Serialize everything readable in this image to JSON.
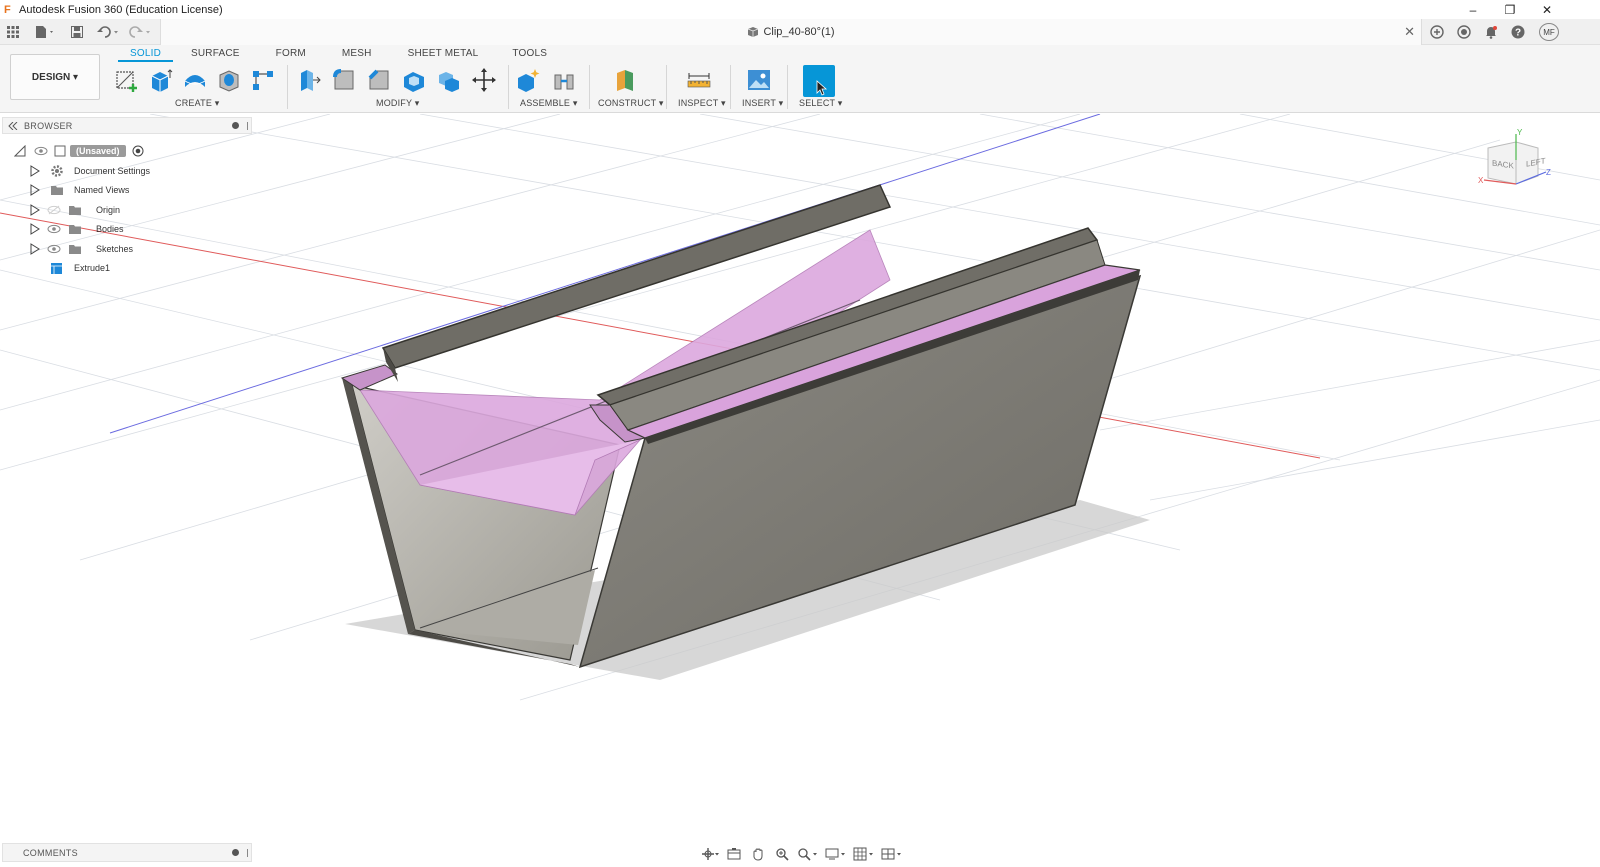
{
  "window": {
    "title": "Autodesk Fusion 360 (Education License)",
    "minimize": "–",
    "restore": "❐",
    "close": "✕"
  },
  "document": {
    "tab_title": "Clip_40-80°(1)",
    "close": "✕"
  },
  "qat": {
    "user_initials": "MF"
  },
  "ribbon": {
    "workspace_button": "DESIGN ▾",
    "tabs": [
      {
        "label": "SOLID",
        "active": true
      },
      {
        "label": "SURFACE",
        "active": false
      },
      {
        "label": "FORM",
        "active": false
      },
      {
        "label": "MESH",
        "active": false
      },
      {
        "label": "SHEET METAL",
        "active": false
      },
      {
        "label": "TOOLS",
        "active": false
      }
    ],
    "groups": {
      "create": "CREATE ▾",
      "modify": "MODIFY ▾",
      "assemble": "ASSEMBLE ▾",
      "construct": "CONSTRUCT ▾",
      "inspect": "INSPECT ▾",
      "insert": "INSERT ▾",
      "select": "SELECT ▾"
    }
  },
  "browser": {
    "header": "BROWSER",
    "root": "(Unsaved)",
    "items": [
      {
        "label": "Document Settings",
        "icon": "gear-icon"
      },
      {
        "label": "Named Views",
        "icon": "folder-icon"
      },
      {
        "label": "Origin",
        "icon": "folder-icon"
      },
      {
        "label": "Bodies",
        "icon": "folder-icon"
      },
      {
        "label": "Sketches",
        "icon": "folder-icon"
      },
      {
        "label": "Extrude1",
        "icon": "timeline-feature-icon"
      }
    ]
  },
  "comments": {
    "header": "COMMENTS"
  },
  "viewcube": {
    "face_back": "BACK",
    "face_left": "LEFT",
    "axis_x": "X",
    "axis_y": "Y",
    "axis_z": "Z"
  },
  "colors": {
    "accent": "#0696d7",
    "body_dark": "#5f5c55",
    "body_mid": "#8a8780",
    "highlight_pink": "#d9a3dc",
    "grid": "#d9dde3",
    "x_axis": "#e05a5a",
    "z_axis": "#6b6be0"
  }
}
